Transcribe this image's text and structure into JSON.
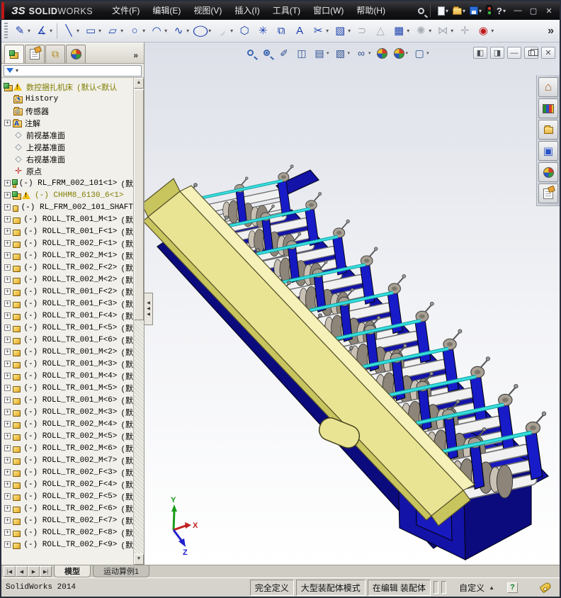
{
  "titlebar": {
    "logo_glyph": "ЗS",
    "brand_bold": "SOLID",
    "brand_light": "WORKS",
    "menus": [
      "文件(F)",
      "编辑(E)",
      "视图(V)",
      "插入(I)",
      "工具(T)",
      "窗口(W)",
      "帮助(H)"
    ],
    "quick_icons": [
      {
        "name": "new-document",
        "dropdown": true
      },
      {
        "name": "open-document",
        "dropdown": true
      },
      {
        "name": "save-document",
        "dropdown": true
      },
      {
        "name": "options-traffic-light",
        "dropdown": false
      },
      {
        "name": "help-question",
        "dropdown": true
      }
    ],
    "window_buttons": [
      {
        "name": "minimize-window",
        "glyph": "—"
      },
      {
        "name": "maximize-window",
        "glyph": "▢"
      },
      {
        "name": "close-window",
        "glyph": "✕"
      }
    ]
  },
  "sketch_toolbar": {
    "items": [
      {
        "name": "sketch",
        "glyph": "✎",
        "color": "#1a3fae",
        "dropdown": true
      },
      {
        "name": "smart-dimension",
        "glyph": "∡",
        "color": "#1a3fae",
        "dropdown": true
      },
      {
        "sep": true
      },
      {
        "name": "line",
        "glyph": "╲",
        "color": "#1a3fae",
        "dropdown": true
      },
      {
        "name": "corner-rectangle",
        "glyph": "▭",
        "color": "#1a3fae",
        "dropdown": true
      },
      {
        "name": "straight-slot",
        "glyph": "▱",
        "color": "#1a3fae",
        "dropdown": true
      },
      {
        "name": "circle",
        "glyph": "○",
        "color": "#1a3fae",
        "dropdown": true
      },
      {
        "name": "centerpoint-arc",
        "glyph": "◠",
        "color": "#1a3fae",
        "dropdown": true
      },
      {
        "name": "spline",
        "glyph": "∿",
        "color": "#1a3fae",
        "dropdown": true
      },
      {
        "name": "ellipse",
        "glyph": "◯",
        "color": "#1a3fae",
        "dropdown": true
      },
      {
        "name": "sketch-fillet",
        "glyph": "◞",
        "color": "#a8adb5",
        "dropdown": true
      },
      {
        "name": "polygon",
        "glyph": "⬡",
        "color": "#1a3fae",
        "dropdown": false
      },
      {
        "name": "point",
        "glyph": "✳",
        "color": "#1a3fae",
        "dropdown": false
      },
      {
        "name": "convert-entities",
        "glyph": "⧉",
        "color": "#1a3fae",
        "dropdown": false
      },
      {
        "name": "sketch-text",
        "glyph": "A",
        "color": "#1a3fae",
        "dropdown": false
      },
      {
        "name": "trim-entities",
        "glyph": "✂",
        "color": "#1a3fae",
        "dropdown": true
      },
      {
        "name": "isometric-sketch",
        "glyph": "▧",
        "color": "#1a3fae",
        "dropdown": true
      },
      {
        "name": "offset-entities",
        "glyph": "⊃",
        "color": "#a8adb5",
        "dropdown": false
      },
      {
        "name": "display-relations",
        "glyph": "△",
        "color": "#a8adb5",
        "dropdown": false
      },
      {
        "name": "linear-sketch-pattern",
        "glyph": "▦",
        "color": "#1a3fae",
        "dropdown": true
      },
      {
        "name": "circular-sketch-pattern",
        "glyph": "✺",
        "color": "#a8adb5",
        "dropdown": true
      },
      {
        "name": "mirror-entities",
        "glyph": "⋈",
        "color": "#a8adb5",
        "dropdown": true
      },
      {
        "name": "move-entities",
        "glyph": "✛",
        "color": "#a8adb5",
        "dropdown": false
      },
      {
        "name": "instant2d",
        "glyph": "◉",
        "color": "#c01818",
        "dropdown": true
      }
    ],
    "overflow_glyph": "»"
  },
  "panel_tabs": {
    "tabs": [
      {
        "name": "featuremanager-tab",
        "active": true
      },
      {
        "name": "propertymanager-tab",
        "active": false
      },
      {
        "name": "configurationmanager-tab",
        "active": false
      },
      {
        "name": "displaymanager-tab",
        "active": false
      }
    ],
    "overflow_glyph": "»"
  },
  "headsup_toolbar": [
    {
      "name": "zoom-to-fit"
    },
    {
      "name": "zoom-to-area"
    },
    {
      "name": "previous-view",
      "glyph": "✐"
    },
    {
      "name": "section-view",
      "glyph": "◫"
    },
    {
      "name": "view-orientation",
      "glyph": "▤",
      "dropdown": true
    },
    {
      "name": "display-style",
      "glyph": "▧",
      "dropdown": true
    },
    {
      "name": "hide-show-items",
      "glyph": "∞",
      "dropdown": true
    },
    {
      "name": "edit-appearance",
      "ball": true
    },
    {
      "name": "apply-scene",
      "ball": true,
      "dropdown": true
    },
    {
      "name": "view-settings",
      "glyph": "▢",
      "dropdown": true
    }
  ],
  "doc_window_buttons": [
    {
      "name": "tile-pane-left",
      "glyph": "◧"
    },
    {
      "name": "tile-pane-right",
      "glyph": "◨"
    },
    {
      "name": "minimize-document",
      "glyph": "—"
    },
    {
      "name": "restore-document",
      "glyph": ""
    },
    {
      "name": "close-document",
      "glyph": "✕"
    }
  ],
  "feature_tree": {
    "filter_value": "",
    "rows": [
      {
        "icon": "asm",
        "warn": true,
        "label": "数控捆扎机床",
        "suffix": "(默认<默认",
        "hl": true,
        "root": true
      },
      {
        "icon": "folder-history",
        "label": "History"
      },
      {
        "icon": "folder-sensors",
        "label": "传感器"
      },
      {
        "icon": "folder-annot",
        "label": "注解",
        "expand": true
      },
      {
        "icon": "plane",
        "label": "前视基准面"
      },
      {
        "icon": "plane",
        "label": "上视基准面"
      },
      {
        "icon": "plane",
        "label": "右视基准面"
      },
      {
        "icon": "origin",
        "label": "原点"
      },
      {
        "icon": "asm",
        "expand": true,
        "prefix": "(-)",
        "label": "RL_FRM_002_101<1>",
        "suffix": "(默"
      },
      {
        "icon": "asm",
        "warn": true,
        "expand": true,
        "prefix": "(-)",
        "label": "CHHM8_6130_6<1>",
        "hl": true
      },
      {
        "icon": "part",
        "expand": true,
        "prefix": "(-)",
        "label": "RL_FRM_002_101_SHAFT"
      },
      {
        "icon": "part",
        "expand": true,
        "prefix": "(-)",
        "label": "ROLL_TR_001_M<1>",
        "suffix": "(默"
      },
      {
        "icon": "part",
        "expand": true,
        "prefix": "(-)",
        "label": "ROLL_TR_001_F<1>",
        "suffix": "(默"
      },
      {
        "icon": "part",
        "expand": true,
        "prefix": "(-)",
        "label": "ROLL_TR_002_F<1>",
        "suffix": "(默"
      },
      {
        "icon": "part",
        "expand": true,
        "prefix": "(-)",
        "label": "ROLL_TR_002_M<1>",
        "suffix": "(默"
      },
      {
        "icon": "part",
        "expand": true,
        "prefix": "(-)",
        "label": "ROLL_TR_002_F<2>",
        "suffix": "(默"
      },
      {
        "icon": "part",
        "expand": true,
        "prefix": "(-)",
        "label": "ROLL_TR_002_M<2>",
        "suffix": "(默"
      },
      {
        "icon": "part",
        "expand": true,
        "prefix": "(-)",
        "label": "ROLL_TR_001_F<2>",
        "suffix": "(默"
      },
      {
        "icon": "part",
        "expand": true,
        "prefix": "(-)",
        "label": "ROLL_TR_001_F<3>",
        "suffix": "(默"
      },
      {
        "icon": "part",
        "expand": true,
        "prefix": "(-)",
        "label": "ROLL_TR_001_F<4>",
        "suffix": "(默"
      },
      {
        "icon": "part",
        "expand": true,
        "prefix": "(-)",
        "label": "ROLL_TR_001_F<5>",
        "suffix": "(默"
      },
      {
        "icon": "part",
        "expand": true,
        "prefix": "(-)",
        "label": "ROLL_TR_001_F<6>",
        "suffix": "(默"
      },
      {
        "icon": "part",
        "expand": true,
        "prefix": "(-)",
        "label": "ROLL_TR_001_M<2>",
        "suffix": "(默"
      },
      {
        "icon": "part",
        "expand": true,
        "prefix": "(-)",
        "label": "ROLL_TR_001_M<3>",
        "suffix": "(默"
      },
      {
        "icon": "part",
        "expand": true,
        "prefix": "(-)",
        "label": "ROLL_TR_001_M<4>",
        "suffix": "(默"
      },
      {
        "icon": "part",
        "expand": true,
        "prefix": "(-)",
        "label": "ROLL_TR_001_M<5>",
        "suffix": "(默"
      },
      {
        "icon": "part",
        "expand": true,
        "prefix": "(-)",
        "label": "ROLL_TR_001_M<6>",
        "suffix": "(默"
      },
      {
        "icon": "part",
        "expand": true,
        "prefix": "(-)",
        "label": "ROLL_TR_002_M<3>",
        "suffix": "(默"
      },
      {
        "icon": "part",
        "expand": true,
        "prefix": "(-)",
        "label": "ROLL_TR_002_M<4>",
        "suffix": "(默"
      },
      {
        "icon": "part",
        "expand": true,
        "prefix": "(-)",
        "label": "ROLL_TR_002_M<5>",
        "suffix": "(默"
      },
      {
        "icon": "part",
        "expand": true,
        "prefix": "(-)",
        "label": "ROLL_TR_002_M<6>",
        "suffix": "(默"
      },
      {
        "icon": "part",
        "expand": true,
        "prefix": "(-)",
        "label": "ROLL_TR_002_M<7>",
        "suffix": "(默"
      },
      {
        "icon": "part",
        "expand": true,
        "prefix": "(-)",
        "label": "ROLL_TR_002_F<3>",
        "suffix": "(默"
      },
      {
        "icon": "part",
        "expand": true,
        "prefix": "(-)",
        "label": "ROLL_TR_002_F<4>",
        "suffix": "(默"
      },
      {
        "icon": "part",
        "expand": true,
        "prefix": "(-)",
        "label": "ROLL_TR_002_F<5>",
        "suffix": "(默"
      },
      {
        "icon": "part",
        "expand": true,
        "prefix": "(-)",
        "label": "ROLL_TR_002_F<6>",
        "suffix": "(默"
      },
      {
        "icon": "part",
        "expand": true,
        "prefix": "(-)",
        "label": "ROLL_TR_002_F<7>",
        "suffix": "(默"
      },
      {
        "icon": "part",
        "expand": true,
        "prefix": "(-)",
        "label": "ROLL_TR_002_F<8>",
        "suffix": "(默"
      },
      {
        "icon": "part",
        "expand": true,
        "prefix": "(-)",
        "label": "ROLL_TR_002_F<9>",
        "suffix": "(默"
      }
    ]
  },
  "model_tabs": {
    "nav_glyphs": [
      "|◀",
      "◀",
      "▶",
      "▶|"
    ],
    "tabs": [
      {
        "label": "模型",
        "active": true
      },
      {
        "label": "运动算例1",
        "active": false
      }
    ]
  },
  "status_bar": {
    "app_version": "SolidWorks 2014",
    "badges": [
      "完全定义",
      "大型装配体模式",
      "在编辑 装配体"
    ],
    "custom_label": "自定义"
  },
  "task_pane": {
    "icons": [
      {
        "name": "solidworks-resources"
      },
      {
        "name": "design-library"
      },
      {
        "name": "file-explorer"
      },
      {
        "name": "view-palette"
      },
      {
        "name": "appearances-scenes"
      },
      {
        "name": "custom-properties"
      }
    ]
  },
  "viewport": {
    "triad": {
      "x": {
        "label": "X",
        "color": "#c02020"
      },
      "y": {
        "label": "Y",
        "color": "#1a9c1a"
      },
      "z": {
        "label": "Z",
        "color": "#2020cc"
      }
    },
    "colors": {
      "beam": "#e9e493",
      "beam_top": "#f5f1b8",
      "beam_dark": "#c9c55e",
      "frame": "#1313a8",
      "frame_dark": "#0b0b7e",
      "frame_mid": "#1919c0",
      "rod": "#38dede",
      "shaft": "#f1f1f1",
      "roller_light": "#c9c1b4",
      "roller_dark": "#8d8579",
      "cap": "#a8a093"
    }
  }
}
